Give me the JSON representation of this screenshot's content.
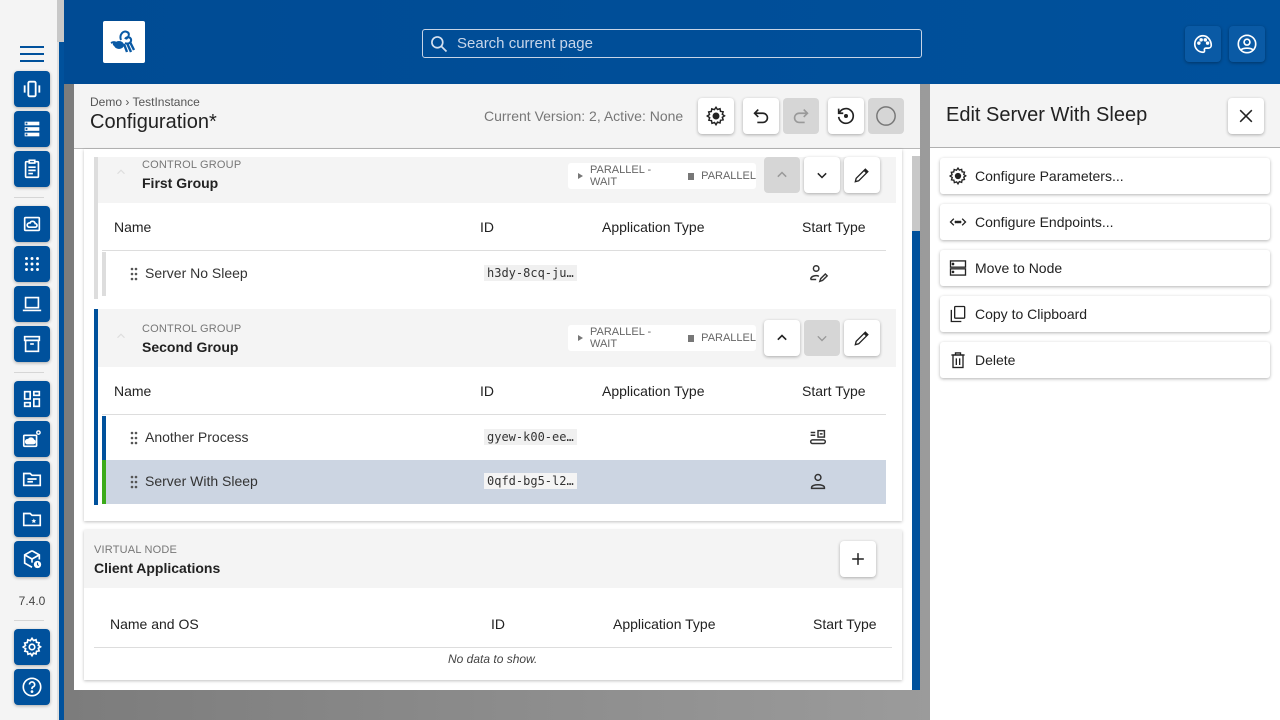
{
  "app": {
    "version": "7.4.0",
    "brand_color": "#00519c"
  },
  "sidebar": {
    "items": [
      {
        "icon": "vibration-icon",
        "label": "Instance Groups"
      },
      {
        "icon": "server-list-icon",
        "label": "Instances"
      },
      {
        "icon": "clipboard-icon",
        "label": "Reports"
      },
      {
        "icon": "cloud-frame-icon",
        "label": "Software Repositories"
      },
      {
        "icon": "apps-grid-icon",
        "label": "Systems"
      },
      {
        "icon": "laptop-icon",
        "label": "Client Applications"
      },
      {
        "icon": "archive-icon",
        "label": "Archive"
      },
      {
        "icon": "dashboard-icon",
        "label": "Dashboard"
      },
      {
        "icon": "cloud-settings-icon",
        "label": "Repository Settings"
      },
      {
        "icon": "folder-icon",
        "label": "Files"
      },
      {
        "icon": "folder-star-icon",
        "label": "Favorites"
      },
      {
        "icon": "box-clock-icon",
        "label": "History"
      },
      {
        "icon": "gear-icon",
        "label": "Settings"
      },
      {
        "icon": "help-icon",
        "label": "Help"
      }
    ]
  },
  "header": {
    "search_placeholder": "Search current page",
    "search_value": ""
  },
  "main": {
    "breadcrumb": "Demo › TestInstance",
    "title": "Configuration*",
    "version_info": "Current Version: 2, Active: None",
    "groups": [
      {
        "kind": "CONTROL GROUP",
        "title": "First Group",
        "start_mode": "PARALLEL - WAIT",
        "stop_mode": "PARALLEL",
        "columns": [
          "Name",
          "ID",
          "Application Type",
          "Start Type"
        ],
        "rows": [
          {
            "name": "Server No Sleep",
            "id": "h3dy-8cq-ju…",
            "app_type": "",
            "start_type": "manual-confirm-icon",
            "selected": false
          }
        ]
      },
      {
        "kind": "CONTROL GROUP",
        "title": "Second Group",
        "start_mode": "PARALLEL - WAIT",
        "stop_mode": "PARALLEL",
        "columns": [
          "Name",
          "ID",
          "Application Type",
          "Start Type"
        ],
        "rows": [
          {
            "name": "Another Process",
            "id": "gyew-k00-ee…",
            "app_type": "",
            "start_type": "instance-start-icon",
            "selected": false
          },
          {
            "name": "Server With Sleep",
            "id": "0qfd-bg5-l2…",
            "app_type": "",
            "start_type": "manual-icon",
            "selected": true
          }
        ]
      }
    ],
    "virtual_node": {
      "kind": "VIRTUAL NODE",
      "title": "Client Applications",
      "columns": [
        "Name and OS",
        "ID",
        "Application Type",
        "Start Type"
      ],
      "empty_text": "No data to show."
    }
  },
  "panel": {
    "title": "Edit Server With Sleep",
    "actions": [
      {
        "label": "Configure Parameters...",
        "icon": "gear-icon"
      },
      {
        "label": "Configure Endpoints...",
        "icon": "endpoints-icon"
      },
      {
        "label": "Move to Node",
        "icon": "server-icon"
      },
      {
        "label": "Copy to Clipboard",
        "icon": "copy-icon"
      },
      {
        "label": "Delete",
        "icon": "delete-icon"
      }
    ]
  }
}
